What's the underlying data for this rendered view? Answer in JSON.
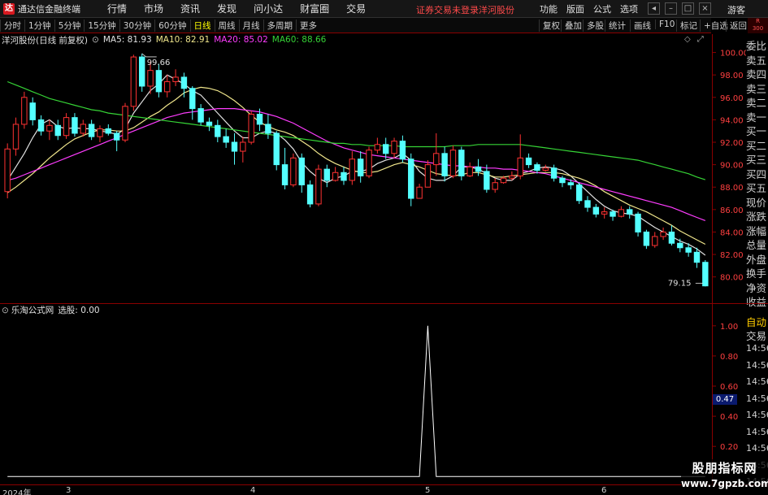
{
  "app": {
    "title": "通达信金融终端",
    "logo": "达",
    "menu": [
      "行情",
      "市场",
      "资讯",
      "发现",
      "问小达",
      "财富圈",
      "交易"
    ],
    "login_notice": "证券交易未登录",
    "stock_name": "洋河股份",
    "right_menu": [
      "功能",
      "版面",
      "公式",
      "选项"
    ],
    "guest": "游客",
    "right_block": [
      "R",
      "300"
    ]
  },
  "toolbar": {
    "periods": [
      "分时",
      "1分钟",
      "5分钟",
      "15分钟",
      "30分钟",
      "60分钟",
      "日线",
      "周线",
      "月线",
      "多周期",
      "更多"
    ],
    "active_period": "日线",
    "right_buttons": [
      "复权",
      "叠加",
      "多股",
      "统计",
      "画线",
      "F10",
      "标记",
      "+自选",
      "返回"
    ]
  },
  "main_chart": {
    "header": "洋河股份(日线 前复权)",
    "ma": [
      {
        "label": "MA5: 81.93",
        "color": "#e0e0e0"
      },
      {
        "label": "MA10: 82.91",
        "color": "#f0e68c"
      },
      {
        "label": "MA20: 85.02",
        "color": "#ff3cff"
      },
      {
        "label": "MA60: 88.66",
        "color": "#36d436"
      }
    ],
    "high_mark": "99.66",
    "low_mark": "79.15"
  },
  "chart_data": [
    {
      "type": "candlestick",
      "title": "洋河股份(日线 前复权)",
      "ylim": [
        78.6,
        101.2
      ],
      "y_ticks": [
        "100.00",
        "98.00",
        "96.00",
        "94.00",
        "92.00",
        "90.00",
        "88.00",
        "86.00",
        "84.00",
        "82.00",
        "80.00"
      ],
      "x_ticks": [
        "2024年",
        "3",
        "4",
        "5",
        "6"
      ],
      "candles": [
        [
          87.6,
          91.4,
          87.0,
          91.9
        ],
        [
          91.4,
          93.6,
          90.8,
          94.2
        ],
        [
          93.6,
          96.0,
          93.2,
          96.5
        ],
        [
          95.5,
          94.0,
          93.5,
          96.0
        ],
        [
          94.0,
          93.0,
          92.6,
          94.4
        ],
        [
          93.0,
          93.5,
          92.2,
          94.0
        ],
        [
          93.5,
          92.6,
          92.2,
          94.0
        ],
        [
          92.6,
          94.2,
          92.3,
          94.6
        ],
        [
          94.2,
          92.8,
          92.5,
          94.6
        ],
        [
          92.8,
          93.6,
          92.5,
          94.0
        ],
        [
          93.6,
          92.5,
          92.2,
          94.0
        ],
        [
          92.5,
          93.2,
          92.0,
          93.5
        ],
        [
          93.2,
          92.8,
          92.6,
          93.6
        ],
        [
          92.8,
          92.2,
          91.2,
          93.0
        ],
        [
          92.2,
          95.2,
          92.0,
          95.5
        ],
        [
          95.2,
          99.6,
          94.8,
          99.8
        ],
        [
          99.6,
          97.0,
          96.5,
          99.9
        ],
        [
          97.0,
          98.4,
          96.3,
          99.2
        ],
        [
          98.4,
          96.5,
          96.0,
          99.0
        ],
        [
          96.5,
          97.4,
          96.0,
          98.0
        ],
        [
          97.4,
          97.8,
          97.0,
          98.5
        ],
        [
          97.8,
          96.8,
          96.0,
          98.2
        ],
        [
          96.8,
          95.0,
          94.0,
          97.0
        ],
        [
          95.0,
          93.8,
          93.5,
          95.4
        ],
        [
          93.8,
          93.5,
          93.0,
          94.2
        ],
        [
          93.5,
          92.5,
          92.0,
          94.0
        ],
        [
          92.5,
          92.0,
          91.5,
          93.2
        ],
        [
          92.0,
          91.2,
          90.0,
          92.8
        ],
        [
          91.2,
          92.0,
          90.2,
          92.5
        ],
        [
          92.0,
          94.5,
          91.8,
          94.8
        ],
        [
          94.5,
          93.6,
          93.0,
          95.0
        ],
        [
          93.6,
          92.8,
          92.3,
          94.5
        ],
        [
          92.8,
          90.0,
          89.5,
          93.0
        ],
        [
          90.0,
          88.2,
          87.8,
          91.5
        ],
        [
          88.2,
          90.6,
          88.0,
          91.0
        ],
        [
          90.6,
          88.2,
          87.5,
          91.0
        ],
        [
          88.2,
          86.5,
          86.2,
          88.6
        ],
        [
          86.5,
          89.6,
          86.3,
          90.0
        ],
        [
          89.6,
          88.6,
          88.0,
          90.0
        ],
        [
          88.6,
          89.3,
          88.5,
          89.8
        ],
        [
          89.3,
          88.6,
          88.2,
          89.8
        ],
        [
          88.6,
          90.5,
          88.2,
          91.2
        ],
        [
          90.5,
          89.0,
          88.4,
          91.2
        ],
        [
          89.0,
          91.3,
          88.8,
          91.6
        ],
        [
          91.3,
          91.8,
          91.0,
          92.4
        ],
        [
          91.8,
          91.0,
          90.5,
          92.4
        ],
        [
          91.0,
          92.1,
          90.6,
          92.4
        ],
        [
          92.1,
          90.5,
          90.2,
          92.6
        ],
        [
          90.5,
          87.0,
          86.3,
          91.0
        ],
        [
          87.0,
          88.0,
          87.6,
          88.3
        ],
        [
          88.0,
          90.0,
          88.0,
          90.4
        ],
        [
          90.0,
          91.0,
          89.0,
          92.8
        ],
        [
          91.0,
          89.0,
          88.5,
          91.6
        ],
        [
          89.0,
          91.3,
          88.8,
          91.7
        ],
        [
          91.3,
          89.0,
          88.6,
          91.6
        ],
        [
          89.0,
          89.8,
          88.9,
          90.2
        ],
        [
          89.8,
          89.4,
          89.0,
          90.5
        ],
        [
          89.4,
          87.8,
          87.5,
          90.0
        ],
        [
          87.8,
          88.4,
          87.5,
          88.8
        ],
        [
          88.4,
          88.8,
          88.3,
          89.0
        ],
        [
          88.8,
          89.0,
          88.6,
          89.4
        ],
        [
          89.0,
          90.6,
          88.7,
          92.7
        ],
        [
          90.6,
          90.0,
          89.7,
          91.0
        ],
        [
          90.0,
          89.5,
          89.2,
          90.2
        ],
        [
          89.5,
          89.7,
          89.4,
          90.0
        ],
        [
          89.7,
          88.8,
          88.5,
          90.0
        ],
        [
          88.8,
          88.4,
          88.0,
          89.0
        ],
        [
          88.4,
          88.2,
          87.8,
          88.7
        ],
        [
          88.2,
          86.8,
          86.5,
          88.4
        ],
        [
          86.8,
          86.2,
          85.8,
          87.2
        ],
        [
          86.2,
          85.6,
          85.3,
          86.5
        ],
        [
          85.6,
          85.8,
          85.2,
          86.2
        ],
        [
          85.8,
          85.4,
          85.0,
          86.0
        ],
        [
          85.4,
          86.0,
          85.3,
          86.3
        ],
        [
          86.0,
          85.6,
          85.2,
          86.3
        ],
        [
          85.6,
          84.0,
          83.6,
          85.8
        ],
        [
          84.0,
          82.8,
          82.5,
          84.2
        ],
        [
          82.8,
          83.6,
          82.6,
          84.0
        ],
        [
          83.6,
          84.0,
          83.3,
          84.4
        ],
        [
          84.0,
          83.0,
          82.8,
          84.6
        ],
        [
          83.0,
          82.6,
          82.2,
          83.4
        ],
        [
          82.6,
          82.2,
          81.8,
          83.0
        ],
        [
          82.2,
          81.3,
          80.8,
          82.6
        ],
        [
          81.3,
          79.2,
          79.15,
          81.5
        ]
      ],
      "series": [
        {
          "name": "MA5",
          "color": "#e0e0e0",
          "values": [
            88.6,
            89.8,
            91.0,
            92.4,
            93.6,
            94.0,
            93.4,
            93.2,
            93.3,
            93.2,
            93.2,
            93.0,
            92.9,
            92.7,
            93.2,
            94.6,
            95.6,
            96.6,
            97.2,
            98.0,
            97.6,
            97.2,
            96.6,
            96.2,
            95.4,
            94.6,
            93.8,
            93.0,
            92.4,
            92.4,
            92.8,
            93.0,
            92.8,
            92.2,
            91.4,
            90.2,
            89.4,
            88.8,
            88.4,
            88.8,
            89.0,
            89.4,
            89.4,
            89.6,
            90.1,
            90.4,
            90.6,
            91.0,
            90.4,
            89.4,
            88.8,
            88.6,
            88.6,
            89.0,
            89.8,
            89.8,
            89.6,
            89.2,
            88.8,
            88.6,
            88.6,
            89.2,
            89.4,
            89.7,
            89.8,
            89.7,
            89.5,
            89.0,
            88.3,
            87.6,
            86.9,
            86.3,
            85.9,
            85.7,
            85.6,
            85.4,
            84.9,
            84.4,
            84.0,
            83.6,
            83.2,
            82.9,
            82.5,
            81.93
          ]
        },
        {
          "name": "MA10",
          "color": "#f0e68c",
          "values": [
            87.5,
            88.0,
            88.6,
            89.2,
            89.9,
            90.6,
            91.2,
            91.8,
            92.3,
            92.6,
            92.9,
            93.1,
            93.1,
            93.0,
            93.0,
            93.3,
            93.8,
            94.3,
            94.7,
            95.3,
            95.8,
            96.4,
            96.7,
            96.9,
            96.8,
            96.6,
            96.2,
            95.7,
            95.1,
            94.4,
            93.8,
            93.4,
            93.1,
            92.9,
            92.6,
            92.1,
            91.6,
            91.0,
            90.5,
            90.1,
            89.8,
            89.5,
            89.3,
            89.3,
            89.4,
            89.7,
            90.0,
            90.2,
            90.0,
            89.8,
            89.5,
            89.2,
            89.1,
            89.0,
            89.1,
            89.3,
            89.3,
            89.1,
            88.9,
            88.9,
            89.0,
            89.1,
            89.2,
            89.3,
            89.3,
            89.3,
            89.2,
            89.0,
            88.8,
            88.5,
            88.1,
            87.6,
            87.2,
            86.8,
            86.4,
            86.1,
            85.8,
            85.4,
            85.0,
            84.6,
            84.1,
            83.7,
            83.3,
            82.91
          ]
        },
        {
          "name": "MA20",
          "color": "#ff3cff",
          "values": [
            88.6,
            88.8,
            89.1,
            89.4,
            89.7,
            90.0,
            90.3,
            90.6,
            90.9,
            91.2,
            91.5,
            91.8,
            92.1,
            92.4,
            92.7,
            93.0,
            93.3,
            93.6,
            93.9,
            94.2,
            94.4,
            94.6,
            94.7,
            94.8,
            94.9,
            95.0,
            95.0,
            95.0,
            94.9,
            94.8,
            94.7,
            94.5,
            94.3,
            94.0,
            93.7,
            93.3,
            92.9,
            92.5,
            92.1,
            91.8,
            91.5,
            91.3,
            91.1,
            90.9,
            90.8,
            90.7,
            90.6,
            90.5,
            90.4,
            90.3,
            90.2,
            90.1,
            90.0,
            89.9,
            89.9,
            89.8,
            89.8,
            89.7,
            89.7,
            89.6,
            89.6,
            89.5,
            89.4,
            89.3,
            89.2,
            89.0,
            88.8,
            88.6,
            88.4,
            88.2,
            88.0,
            87.8,
            87.6,
            87.4,
            87.2,
            87.0,
            86.8,
            86.6,
            86.4,
            86.2,
            85.9,
            85.6,
            85.3,
            85.02
          ]
        },
        {
          "name": "MA60",
          "color": "#36d436",
          "values": [
            97.4,
            97.1,
            96.8,
            96.5,
            96.2,
            95.9,
            95.7,
            95.5,
            95.3,
            95.1,
            94.9,
            94.8,
            94.6,
            94.5,
            94.4,
            94.3,
            94.2,
            94.1,
            94.0,
            93.9,
            93.8,
            93.7,
            93.6,
            93.5,
            93.4,
            93.3,
            93.2,
            93.1,
            93.0,
            92.9,
            92.8,
            92.7,
            92.6,
            92.5,
            92.4,
            92.3,
            92.2,
            92.1,
            92.0,
            91.9,
            91.9,
            91.8,
            91.8,
            91.7,
            91.7,
            91.7,
            91.7,
            91.6,
            91.6,
            91.6,
            91.6,
            91.6,
            91.6,
            91.7,
            91.7,
            91.7,
            91.8,
            91.8,
            91.8,
            91.8,
            91.8,
            91.8,
            91.7,
            91.6,
            91.5,
            91.4,
            91.3,
            91.2,
            91.1,
            91.0,
            90.9,
            90.8,
            90.7,
            90.6,
            90.5,
            90.4,
            90.2,
            90.0,
            89.8,
            89.6,
            89.4,
            89.2,
            88.9,
            88.66
          ]
        }
      ]
    },
    {
      "type": "line",
      "title": "乐淘公式网",
      "ylim": [
        -0.02,
        1.08
      ],
      "y_ticks": [
        "1.00",
        "0.80",
        "0.60",
        "0.40",
        "0.20"
      ],
      "series": [
        {
          "name": "选股",
          "color": "#ffffff",
          "values": [
            0,
            0,
            0,
            0,
            0,
            0,
            0,
            0,
            0,
            0,
            0,
            0,
            0,
            0,
            0,
            0,
            0,
            0,
            0,
            0,
            0,
            0,
            0,
            0,
            0,
            0,
            0,
            0,
            0,
            0,
            0,
            0,
            0,
            0,
            0,
            0,
            0,
            0,
            0,
            0,
            0,
            0,
            0,
            0,
            0,
            0,
            0,
            0,
            0,
            0,
            1,
            0,
            0,
            0,
            0,
            0,
            0,
            0,
            0,
            0,
            0,
            0,
            0,
            0,
            0,
            0,
            0,
            0,
            0,
            0,
            0,
            0,
            0,
            0,
            0,
            0,
            0,
            0,
            0,
            0,
            0,
            0,
            0,
            0
          ]
        }
      ]
    }
  ],
  "indicator": {
    "header": "乐淘公式网",
    "value_label": "选股: 0.00",
    "current_value": "0.47"
  },
  "side_panel": {
    "labels": [
      "委比",
      "卖五",
      "卖四",
      "卖三",
      "卖二",
      "卖一",
      "买一",
      "买二",
      "买三",
      "买四",
      "买五",
      "现价",
      "涨跌",
      "涨幅",
      "总量",
      "外盘",
      "换手",
      "净资",
      "收益"
    ],
    "lower_labels": [
      "自动",
      "交易",
      "14:56",
      "14:56",
      "14:56",
      "14:56",
      "14:56",
      "14:56",
      "14:56",
      "14:56",
      "14:56"
    ]
  },
  "watermark": {
    "line1": "股朋指标网",
    "line2": "www.7gpzb.com"
  }
}
